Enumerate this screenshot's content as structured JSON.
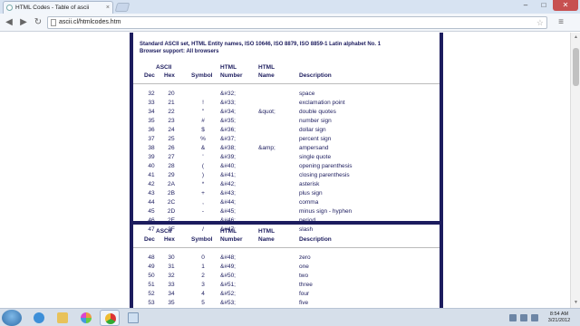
{
  "browser": {
    "tab_title": "HTML Codes - Table of ascii",
    "tab_close": "×",
    "url": "ascii.cl/htmlcodes.htm",
    "window_controls": [
      "–",
      "□",
      "✕"
    ]
  },
  "page": {
    "heading_line1": "Standard ASCII set, HTML Entity names, ISO 10646, ISO 8879, ISO 8859-1 Latin alphabet No. 1",
    "heading_line2": "Browser support: All browsers",
    "columns": {
      "ascii": "ASCII",
      "dec": "Dec",
      "hex": "Hex",
      "symbol": "Symbol",
      "html_number_1": "HTML",
      "html_number_2": "Number",
      "html_name_1": "HTML",
      "html_name_2": "Name",
      "description": "Description"
    },
    "section1": [
      {
        "dec": "32",
        "hex": "20",
        "sym": "",
        "num": "&#32;",
        "name": "",
        "desc": "space"
      },
      {
        "dec": "33",
        "hex": "21",
        "sym": "!",
        "num": "&#33;",
        "name": "",
        "desc": "exclamation point"
      },
      {
        "dec": "34",
        "hex": "22",
        "sym": "\"",
        "num": "&#34;",
        "name": "&quot;",
        "desc": "double quotes"
      },
      {
        "dec": "35",
        "hex": "23",
        "sym": "#",
        "num": "&#35;",
        "name": "",
        "desc": "number sign"
      },
      {
        "dec": "36",
        "hex": "24",
        "sym": "$",
        "num": "&#36;",
        "name": "",
        "desc": "dollar sign"
      },
      {
        "dec": "37",
        "hex": "25",
        "sym": "%",
        "num": "&#37;",
        "name": "",
        "desc": "percent sign"
      },
      {
        "dec": "38",
        "hex": "26",
        "sym": "&",
        "num": "&#38;",
        "name": "&amp;",
        "desc": "ampersand"
      },
      {
        "dec": "39",
        "hex": "27",
        "sym": "'",
        "num": "&#39;",
        "name": "",
        "desc": "single quote"
      },
      {
        "dec": "40",
        "hex": "28",
        "sym": "(",
        "num": "&#40;",
        "name": "",
        "desc": "opening parenthesis"
      },
      {
        "dec": "41",
        "hex": "29",
        "sym": ")",
        "num": "&#41;",
        "name": "",
        "desc": "closing parenthesis"
      },
      {
        "dec": "42",
        "hex": "2A",
        "sym": "*",
        "num": "&#42;",
        "name": "",
        "desc": "asterisk"
      },
      {
        "dec": "43",
        "hex": "2B",
        "sym": "+",
        "num": "&#43;",
        "name": "",
        "desc": "plus sign"
      },
      {
        "dec": "44",
        "hex": "2C",
        "sym": ",",
        "num": "&#44;",
        "name": "",
        "desc": "comma"
      },
      {
        "dec": "45",
        "hex": "2D",
        "sym": "-",
        "num": "&#45;",
        "name": "",
        "desc": "minus sign - hyphen"
      },
      {
        "dec": "46",
        "hex": "2E",
        "sym": ".",
        "num": "&#46;",
        "name": "",
        "desc": "period"
      },
      {
        "dec": "47",
        "hex": "2F",
        "sym": "/",
        "num": "&#47;",
        "name": "",
        "desc": "slash"
      }
    ],
    "section2": [
      {
        "dec": "48",
        "hex": "30",
        "sym": "0",
        "num": "&#48;",
        "name": "",
        "desc": "zero"
      },
      {
        "dec": "49",
        "hex": "31",
        "sym": "1",
        "num": "&#49;",
        "name": "",
        "desc": "one"
      },
      {
        "dec": "50",
        "hex": "32",
        "sym": "2",
        "num": "&#50;",
        "name": "",
        "desc": "two"
      },
      {
        "dec": "51",
        "hex": "33",
        "sym": "3",
        "num": "&#51;",
        "name": "",
        "desc": "three"
      },
      {
        "dec": "52",
        "hex": "34",
        "sym": "4",
        "num": "&#52;",
        "name": "",
        "desc": "four"
      },
      {
        "dec": "53",
        "hex": "35",
        "sym": "5",
        "num": "&#53;",
        "name": "",
        "desc": "five"
      },
      {
        "dec": "54",
        "hex": "36",
        "sym": "6",
        "num": "&#54;",
        "name": "",
        "desc": "six"
      }
    ]
  },
  "taskbar": {
    "clock_time": "8:54 AM",
    "clock_date": "3/21/2012",
    "icons": [
      "start-orb",
      "ie-icon",
      "explorer-folder-icon",
      "picasa-icon",
      "chrome-icon",
      "notepad-icon"
    ]
  },
  "colors": {
    "text": "#1c1c5e",
    "frame": "#1c1c5e",
    "chrome_bg": "#d7e3f2",
    "taskbar_bg": "#d6dfea"
  }
}
